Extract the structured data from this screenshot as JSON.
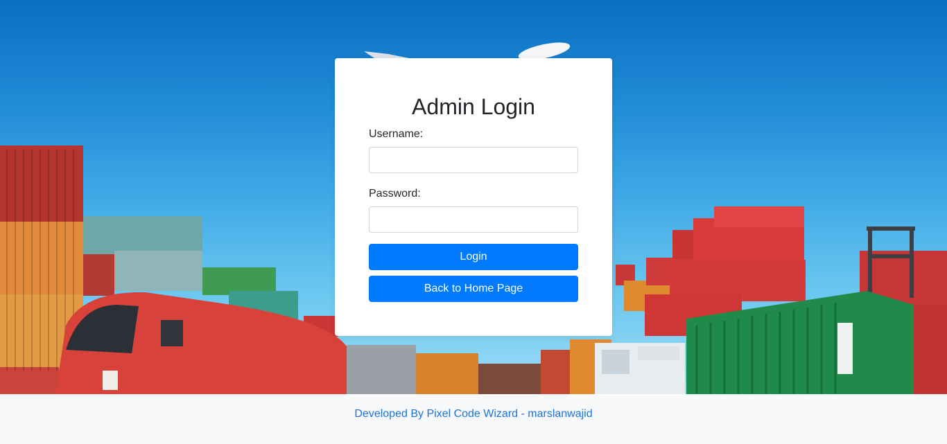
{
  "login": {
    "title": "Admin Login",
    "username_label": "Username:",
    "username_value": "",
    "password_label": "Password:",
    "password_value": "",
    "login_button": "Login",
    "home_button": "Back to Home Page"
  },
  "footer": {
    "credit": "Developed By Pixel Code Wizard - marslanwajid"
  },
  "colors": {
    "primary": "#007bff",
    "footer_link": "#1a73d9",
    "footer_bg": "#f8f9fa"
  }
}
